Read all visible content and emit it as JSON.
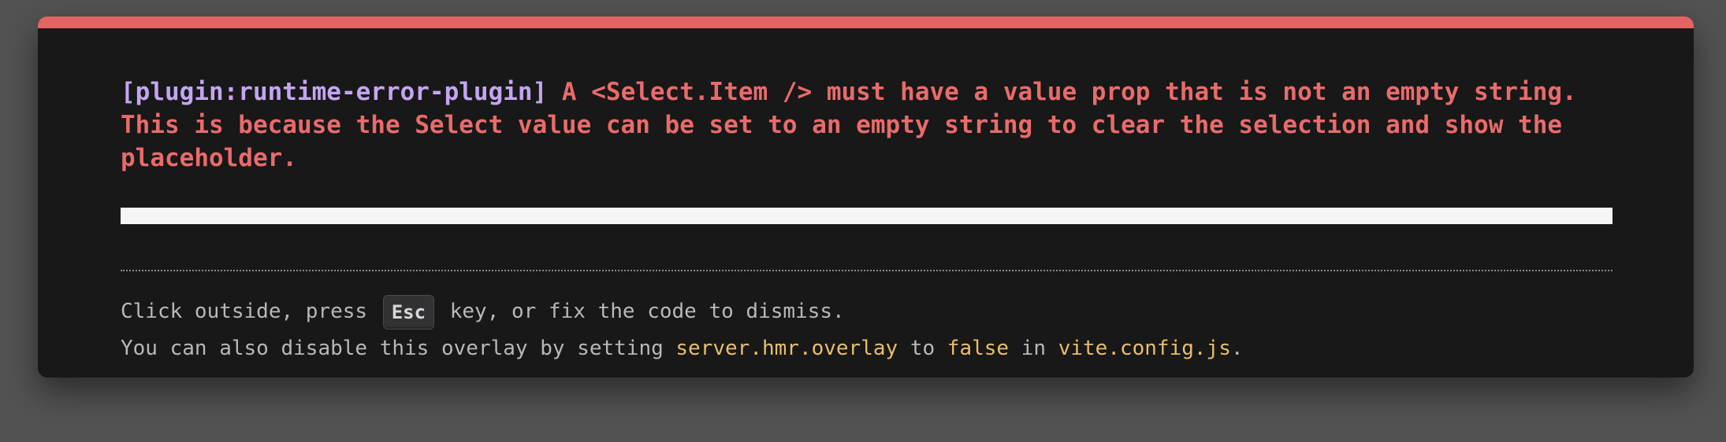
{
  "overlay": {
    "plugin_tag": "[plugin:runtime-error-plugin]",
    "message": " A <Select.Item /> must have a value prop that is not an empty string. This is because the Select value can be set to an empty string to clear the selection and show the placeholder.",
    "stack": "",
    "tip": {
      "line1_before": "Click outside, press ",
      "key": "Esc",
      "line1_after": " key, or fix the code to dismiss.",
      "line2_a": "You can also disable this overlay by setting ",
      "config_option": "server.hmr.overlay",
      "line2_b": " to ",
      "value": "false",
      "line2_c": " in ",
      "config_file": "vite.config.js",
      "line2_d": "."
    },
    "colors": {
      "accent_bar": "#e46363",
      "error_text": "#e96b6b",
      "plugin_text": "#c3a6f2",
      "code_text": "#e9be6a",
      "background": "#181818"
    }
  }
}
